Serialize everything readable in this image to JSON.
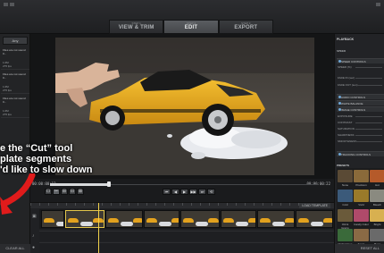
{
  "topbar": {
    "steps": [
      {
        "num": "STEP 1",
        "label": "VIEW & TRIM"
      },
      {
        "num": "STEP 2",
        "label": "EDIT",
        "active": true
      },
      {
        "num": "STEP 3",
        "label": "EXPORT"
      }
    ]
  },
  "left_panel": {
    "button": "Any",
    "items": [
      {
        "title": "Files are not sound 0...",
        "meta1": "1.0M",
        "meta2": "275 fps"
      },
      {
        "title": "Files are not sound 0...",
        "meta1": "1.0M",
        "meta2": "275 fps"
      },
      {
        "title": "Files are not sound 0...",
        "meta1": "1.0M",
        "meta2": "275 fps"
      }
    ],
    "footer": "CLEAR ALL"
  },
  "scrubber": {
    "time_start": "00:00:00:12",
    "time_end": "00:00:00:22",
    "progress": 0.22
  },
  "transport": {
    "buttons": [
      "⏮",
      "◀",
      "▶",
      "▶▶",
      "⏭",
      "⟲"
    ]
  },
  "tools": [
    "⊡",
    "✂",
    "⊞",
    "⊟",
    "⊠"
  ],
  "timeline": {
    "load_template": "LOAD TEMPLATE",
    "playhead_fraction": 0.2
  },
  "right_panel": {
    "playback": "PLAYBACK",
    "speed_header": "SPEED",
    "speed_controls": "SPEED CONTROLS",
    "speed_rows": [
      "SPEED (%)",
      "FADE IN (sec)",
      "FADE OUT (sec)"
    ],
    "audio_controls": "AUDIO CONTROLS",
    "white_balance": "WHITE BALANCE",
    "image_controls": "IMAGE CONTROLS",
    "image_rows": [
      "EXPOSURE",
      "CONTRAST",
      "SATURATION",
      "SHARPNESS",
      "SMOOTHNESS"
    ],
    "tracking": "TRACKING CONTROLS",
    "presets_header": "PRESETS",
    "presets": [
      {
        "label": "None",
        "color": "#5a4a35"
      },
      {
        "label": "Precision",
        "color": "#8a6a3a"
      },
      {
        "label": "Hot",
        "color": "#b55a2a"
      },
      {
        "label": "Cold",
        "color": "#3b5a7a"
      },
      {
        "label": "Vivid",
        "color": "#9a7a2a"
      },
      {
        "label": "Bleach",
        "color": "#8a8a80"
      },
      {
        "label": "Old & Grainy",
        "color": "#6a5a3a"
      },
      {
        "label": "Candy Color",
        "color": "#b04a6a"
      },
      {
        "label": "Bright",
        "color": "#d8b050"
      },
      {
        "label": "Night Vision",
        "color": "#3a6a3a"
      },
      {
        "label": "Sepia",
        "color": "#8a6a45"
      },
      {
        "label": "Mono",
        "color": "#6a6a6a"
      }
    ],
    "footer": "RESET ALL"
  },
  "overlay": {
    "line1": "e the “Cut” tool",
    "line2": "plate segments",
    "line3": "'d like to slow down"
  },
  "colors": {
    "accent": "#f2d34b",
    "arrow": "#e01b1b"
  }
}
